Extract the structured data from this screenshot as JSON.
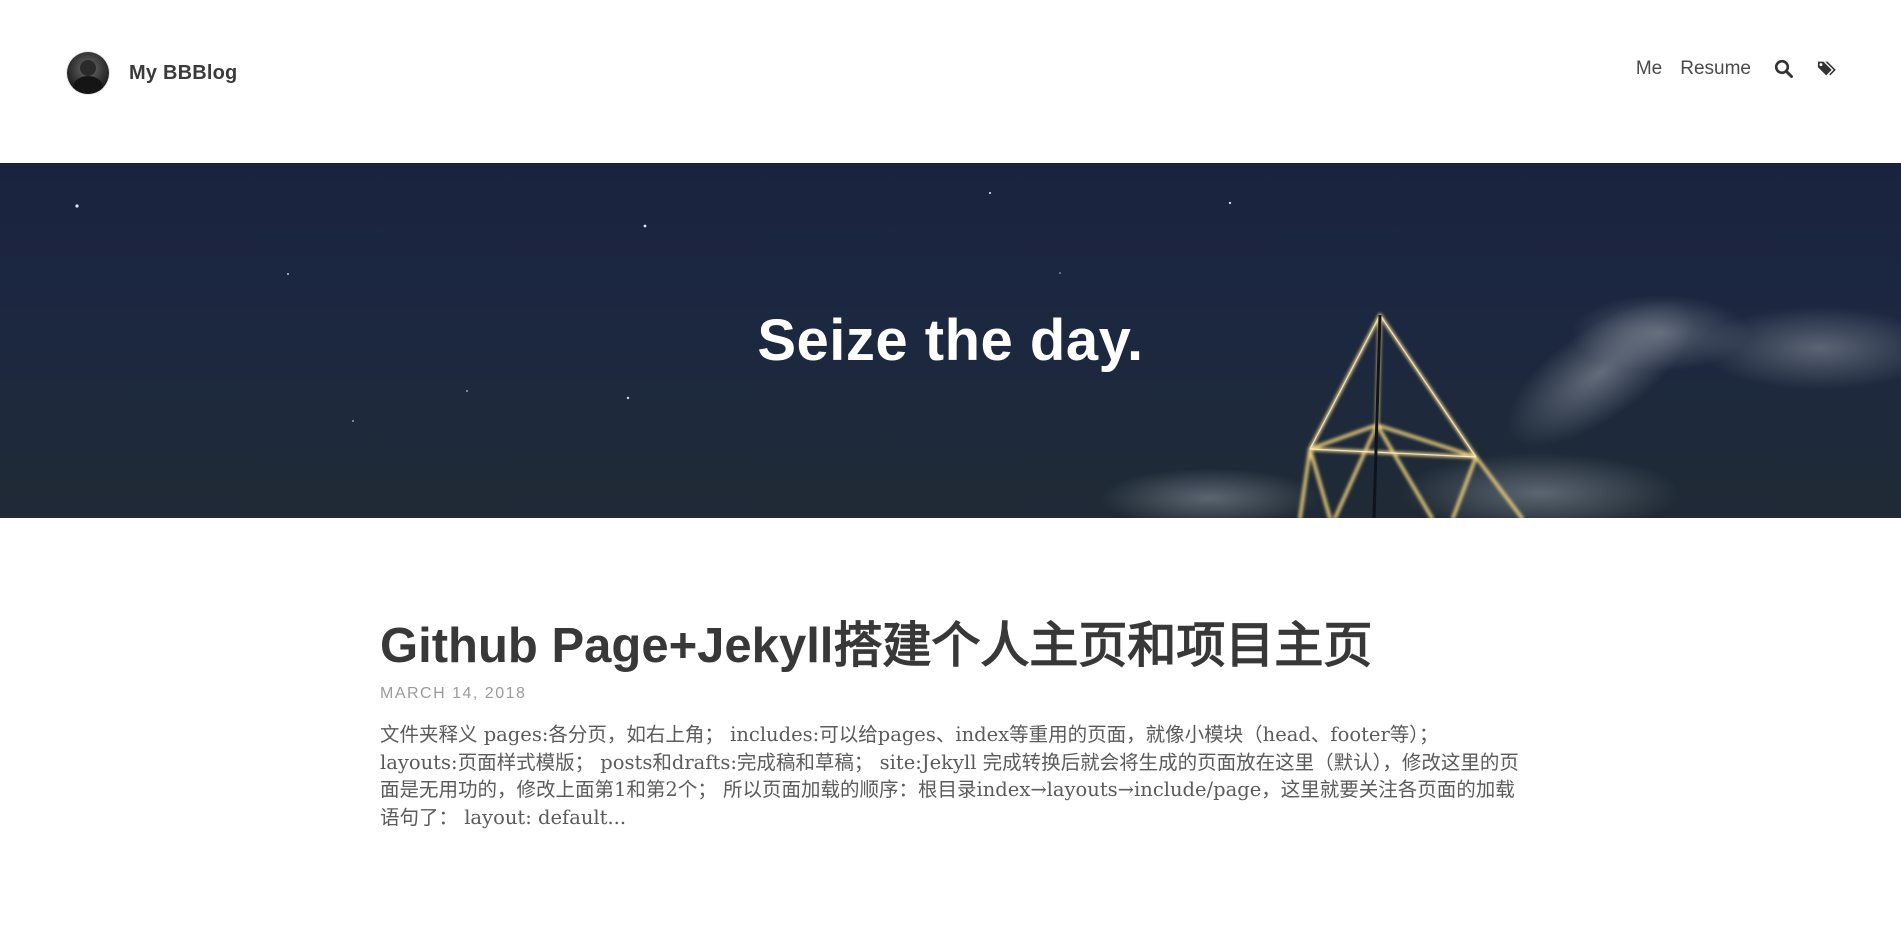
{
  "header": {
    "blog_title": "My BBBlog",
    "nav": [
      {
        "label": "Me"
      },
      {
        "label": "Resume"
      }
    ],
    "icons": [
      "search-icon",
      "tags-icon"
    ]
  },
  "hero": {
    "title": "Seize the day."
  },
  "post": {
    "title": "Github Page+Jekyll搭建个人主页和项目主页",
    "date": "MARCH 14, 2018",
    "excerpt": "文件夹释义 pages:各分页，如右上角； includes:可以给pages、index等重用的页面，就像小模块（head、footer等）； layouts:页面样式模版； posts和drafts:完成稿和草稿； site:Jekyll 完成转换后就会将生成的页面放在这里（默认），修改这里的页面是无用功的，修改上面第1和第2个； 所以页面加载的顺序：根目录index→layouts→include/page，这里就要关注各页面的加载语句了： layout: default..."
  },
  "colors": {
    "hero_sky": "#1c2740",
    "hero_text": "#ffffff",
    "tower_light": "#f1d27a",
    "title_text": "#383838",
    "date_text": "#9b9b9b"
  }
}
